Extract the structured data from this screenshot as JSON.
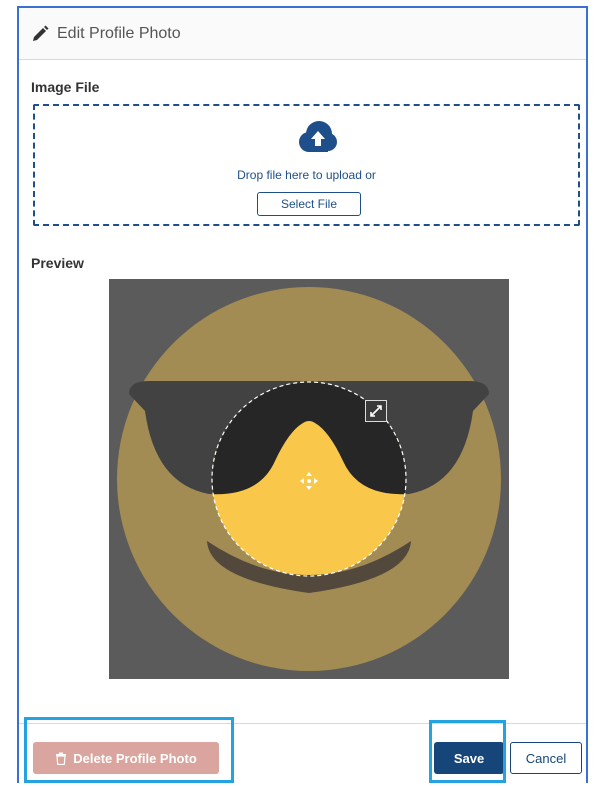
{
  "modal": {
    "title": "Edit Profile Photo",
    "title_icon": "pencil-icon"
  },
  "image_file": {
    "label": "Image File",
    "upload_icon": "cloud-upload-icon",
    "drop_text": "Drop file here to upload or",
    "select_button": "Select File"
  },
  "preview": {
    "label": "Preview",
    "move_icon": "move-icon",
    "resize_icon": "expand-icon"
  },
  "footer": {
    "delete_button": "Delete Profile Photo",
    "delete_icon": "trash-icon",
    "save_button": "Save",
    "cancel_button": "Cancel"
  },
  "colors": {
    "accent": "#16457a",
    "highlight": "#24a3e0",
    "delete_disabled": "#d9a59e",
    "emoji_yellow": "#f9c84a"
  }
}
